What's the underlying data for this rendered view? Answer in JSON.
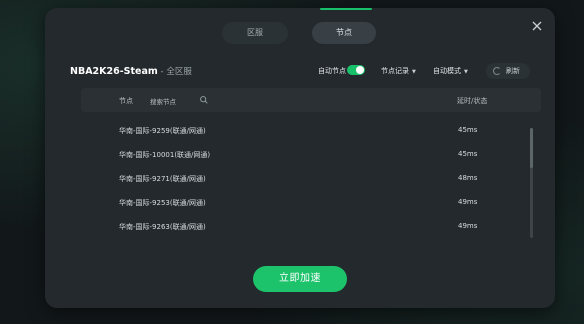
{
  "tabs": [
    {
      "label": "区服"
    },
    {
      "label": "节点"
    }
  ],
  "game": {
    "title": "NBA2K26-Steam",
    "separator": " - ",
    "region": "全区服"
  },
  "controls": {
    "auto_node_label": "自动节点",
    "auto_node_on": true,
    "node_record_label": "节点记录",
    "auto_mode_label": "自动模式",
    "refresh_label": "刷新"
  },
  "table": {
    "col_node": "节点",
    "search_placeholder": "搜索节点",
    "col_latency": "延时/状态",
    "rows": [
      {
        "name": "华南-国际-9259(联通/网通)",
        "latency": "45ms"
      },
      {
        "name": "华南-国际-10001(联通/网通)",
        "latency": "45ms"
      },
      {
        "name": "华南-国际-9271(联通/网通)",
        "latency": "48ms"
      },
      {
        "name": "华南-国际-9253(联通/网通)",
        "latency": "49ms"
      },
      {
        "name": "华南-国际-9263(联通/网通)",
        "latency": "49ms"
      }
    ]
  },
  "accelerate_label": "立即加速",
  "colors": {
    "accent": "#1cc36b",
    "panel": "#23292d"
  }
}
